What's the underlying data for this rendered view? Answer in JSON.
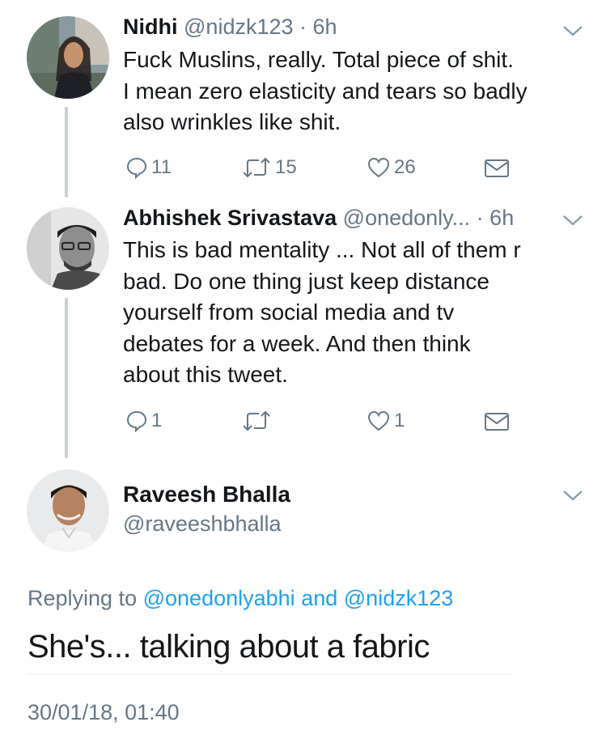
{
  "tweets": [
    {
      "name": "Nidhi",
      "handle": "@nidzk123",
      "time": "· 6h",
      "lines": [
        "Fuck Muslins, really. Total piece of shit.",
        "I mean zero elasticity and tears so badly",
        "also wrinkles like shit."
      ],
      "replies": "11",
      "retweets": "15",
      "likes": "26"
    },
    {
      "name": "Abhishek Srivastava",
      "handle": "@onedonly...",
      "time": "· 6h",
      "lines": [
        "This is bad mentality ... Not all of them r",
        "bad. Do one thing just keep distance",
        "yourself from social media and tv",
        "debates for a week. And then think",
        "about this tweet."
      ],
      "replies": "1",
      "retweets": "",
      "likes": "1"
    }
  ],
  "main_tweet": {
    "name": "Raveesh Bhalla",
    "handle": "@raveeshbhalla",
    "replying_prefix": "Replying to",
    "mention_1": "@onedonlyabhi",
    "mention_and": "and",
    "mention_2": "@nidzk123",
    "text": "She's... talking about a fabric",
    "timestamp": "30/01/18, 01:40"
  },
  "colors": {
    "text": "#14171a",
    "muted": "#657786",
    "accent": "#1da1f2",
    "thread_line": "#c8d0d7"
  },
  "icons": [
    "reply-icon",
    "retweet-icon",
    "like-icon",
    "message-icon",
    "chevron-down-icon"
  ]
}
